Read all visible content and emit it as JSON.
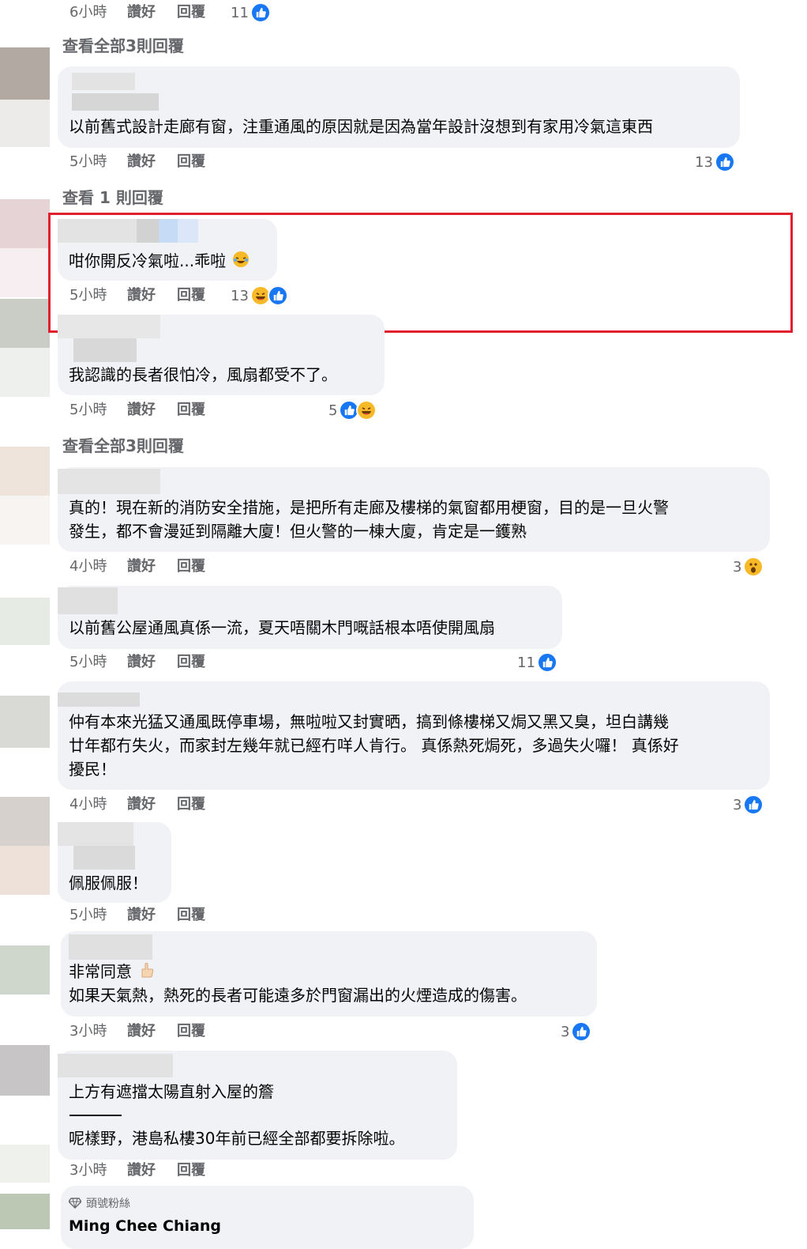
{
  "colors": {
    "bubble": "#f0f2f5",
    "meta_text": "#65676b",
    "like_blue": "#1877f2",
    "highlight_red": "#e0202c",
    "emoji_yellow": "#f7b928"
  },
  "icons": [
    "like-icon",
    "laugh-icon",
    "wow-icon",
    "laugh-crying-icon",
    "thumbs-up-hand-icon",
    "top-fan-diamond-icon"
  ],
  "actions": {
    "like_label": "讚好",
    "reply_label": "回覆"
  },
  "top_meta": {
    "time": "6小時",
    "reaction_count": "11"
  },
  "view_replies": {
    "first": "查看全部3則回覆",
    "second": "查看 1 則回覆",
    "third": "查看全部3則回覆"
  },
  "comments": [
    {
      "text": "以前舊式設計走廊有窗，注重通風的原因就是因為當年設計沒想到有家用冷氣這東西",
      "time": "5小時",
      "reaction_count": "13"
    },
    {
      "text": "咁你開反冷氣啦...乖啦",
      "time": "5小時",
      "reaction_count": "13"
    },
    {
      "text": "我認識的長者很怕冷，風扇都受不了。",
      "time": "5小時",
      "reaction_count": "5"
    },
    {
      "text_line1": "真的！現在新的消防安全措施，是把所有走廊及樓梯的氣窗都用梗窗，目的是一旦火警",
      "text_line2": "發生，都不會漫延到隔離大廈！但火警的一棟大廈，肯定是一鑊熟",
      "time": "4小時",
      "reaction_count": "3"
    },
    {
      "text": "以前舊公屋通風真係一流，夏天唔關木門嘅話根本唔使開風扇",
      "time": "5小時",
      "reaction_count": "11"
    },
    {
      "text_line1": "仲有本來光猛又通風既停車場，無啦啦又封實晒，搞到條樓梯又焗又黑又臭，坦白講幾",
      "text_line2": "廿年都冇失火，而家封左幾年就已經冇咩人肯行。 真係熱死焗死，多過失火囉！ 真係好",
      "text_line3": "擾民！",
      "time": "4小時",
      "reaction_count": "3"
    },
    {
      "text": "佩服佩服！",
      "time": "5小時"
    },
    {
      "text_line1": "非常同意",
      "text_line2": "如果天氣熱，熱死的長者可能遠多於門窗漏出的火煙造成的傷害。",
      "time": "3小時",
      "reaction_count": "3"
    },
    {
      "text_line1": "上方有遮擋太陽直射入屋的簷",
      "text_line2": "呢樣野，港島私樓30年前已經全部都要拆除啦。",
      "time": "3小時"
    }
  ],
  "last_comment": {
    "badge": "頭號粉絲",
    "author": "Ming Chee Chiang"
  }
}
